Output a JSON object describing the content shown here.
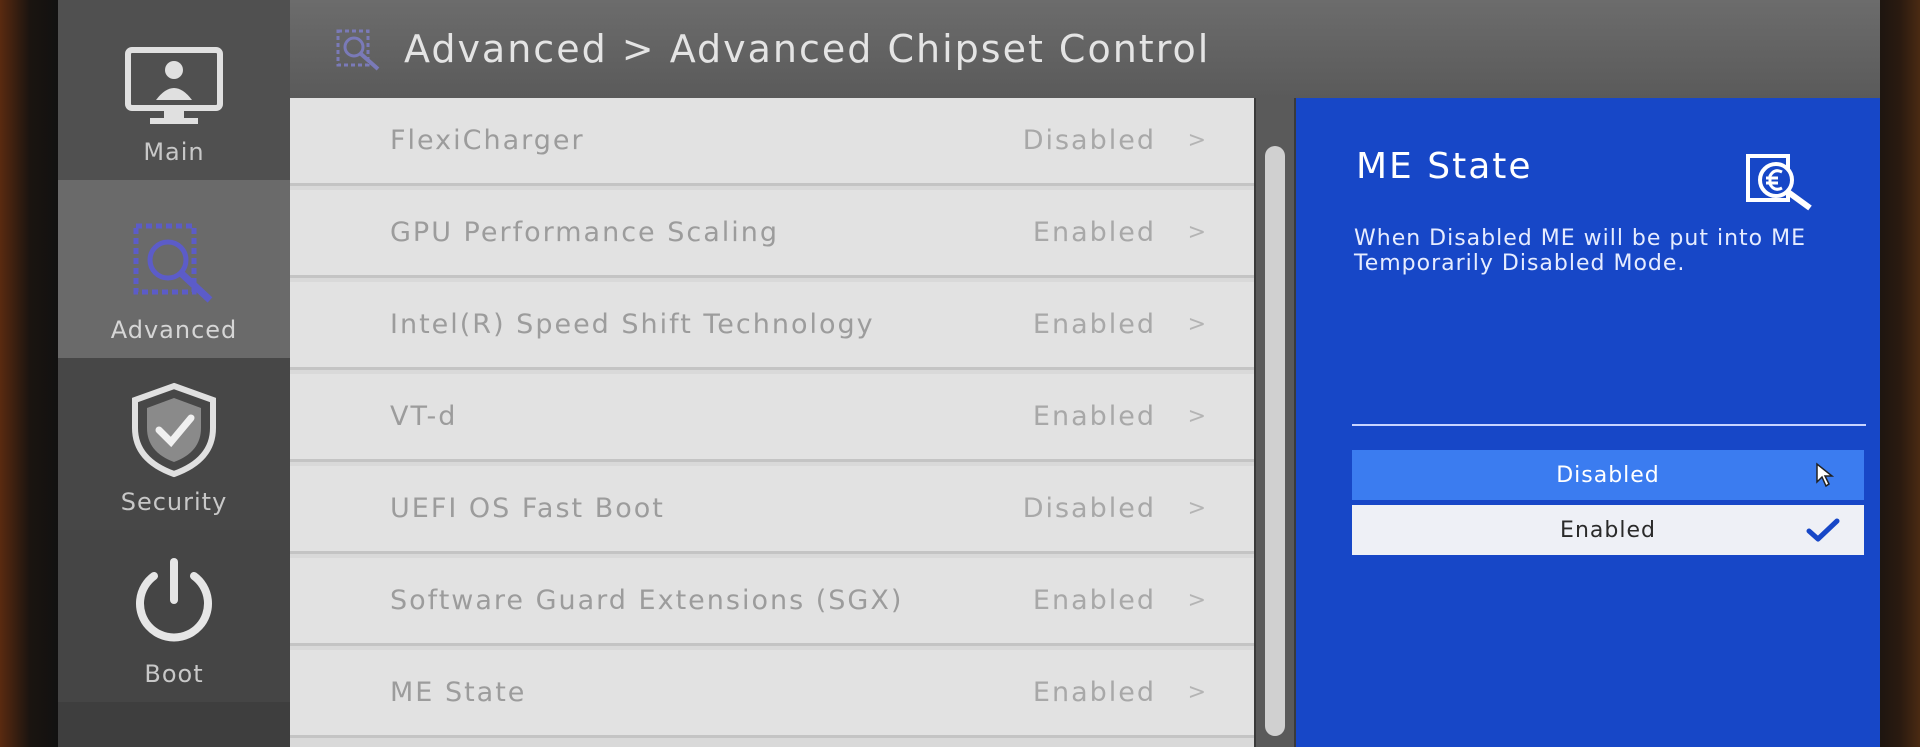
{
  "sidebar": {
    "items": [
      {
        "label": "Main",
        "icon": "monitor-user-icon"
      },
      {
        "label": "Advanced",
        "icon": "chip-magnify-icon"
      },
      {
        "label": "Security",
        "icon": "shield-check-icon"
      },
      {
        "label": "Boot",
        "icon": "power-icon"
      }
    ]
  },
  "header": {
    "breadcrumb": "Advanced > Advanced Chipset Control",
    "icon": "chip-magnify-icon"
  },
  "settings": [
    {
      "label": "FlexiCharger",
      "value": "Disabled"
    },
    {
      "label": "GPU Performance Scaling",
      "value": "Enabled"
    },
    {
      "label": "Intel(R) Speed Shift Technology",
      "value": "Enabled"
    },
    {
      "label": "VT-d",
      "value": "Enabled"
    },
    {
      "label": "UEFI OS Fast Boot",
      "value": "Disabled"
    },
    {
      "label": "Software Guard Extensions (SGX)",
      "value": "Enabled"
    },
    {
      "label": "ME State",
      "value": "Enabled"
    }
  ],
  "chevron": ">",
  "help_panel": {
    "title": "ME State",
    "description": "When Disabled ME will be put into ME Temporarily Disabled Mode.",
    "options": [
      {
        "label": "Disabled",
        "state": "hovered"
      },
      {
        "label": "Enabled",
        "state": "selected"
      }
    ],
    "accent_color": "#1747c7",
    "hover_color": "#3b7cf0"
  }
}
